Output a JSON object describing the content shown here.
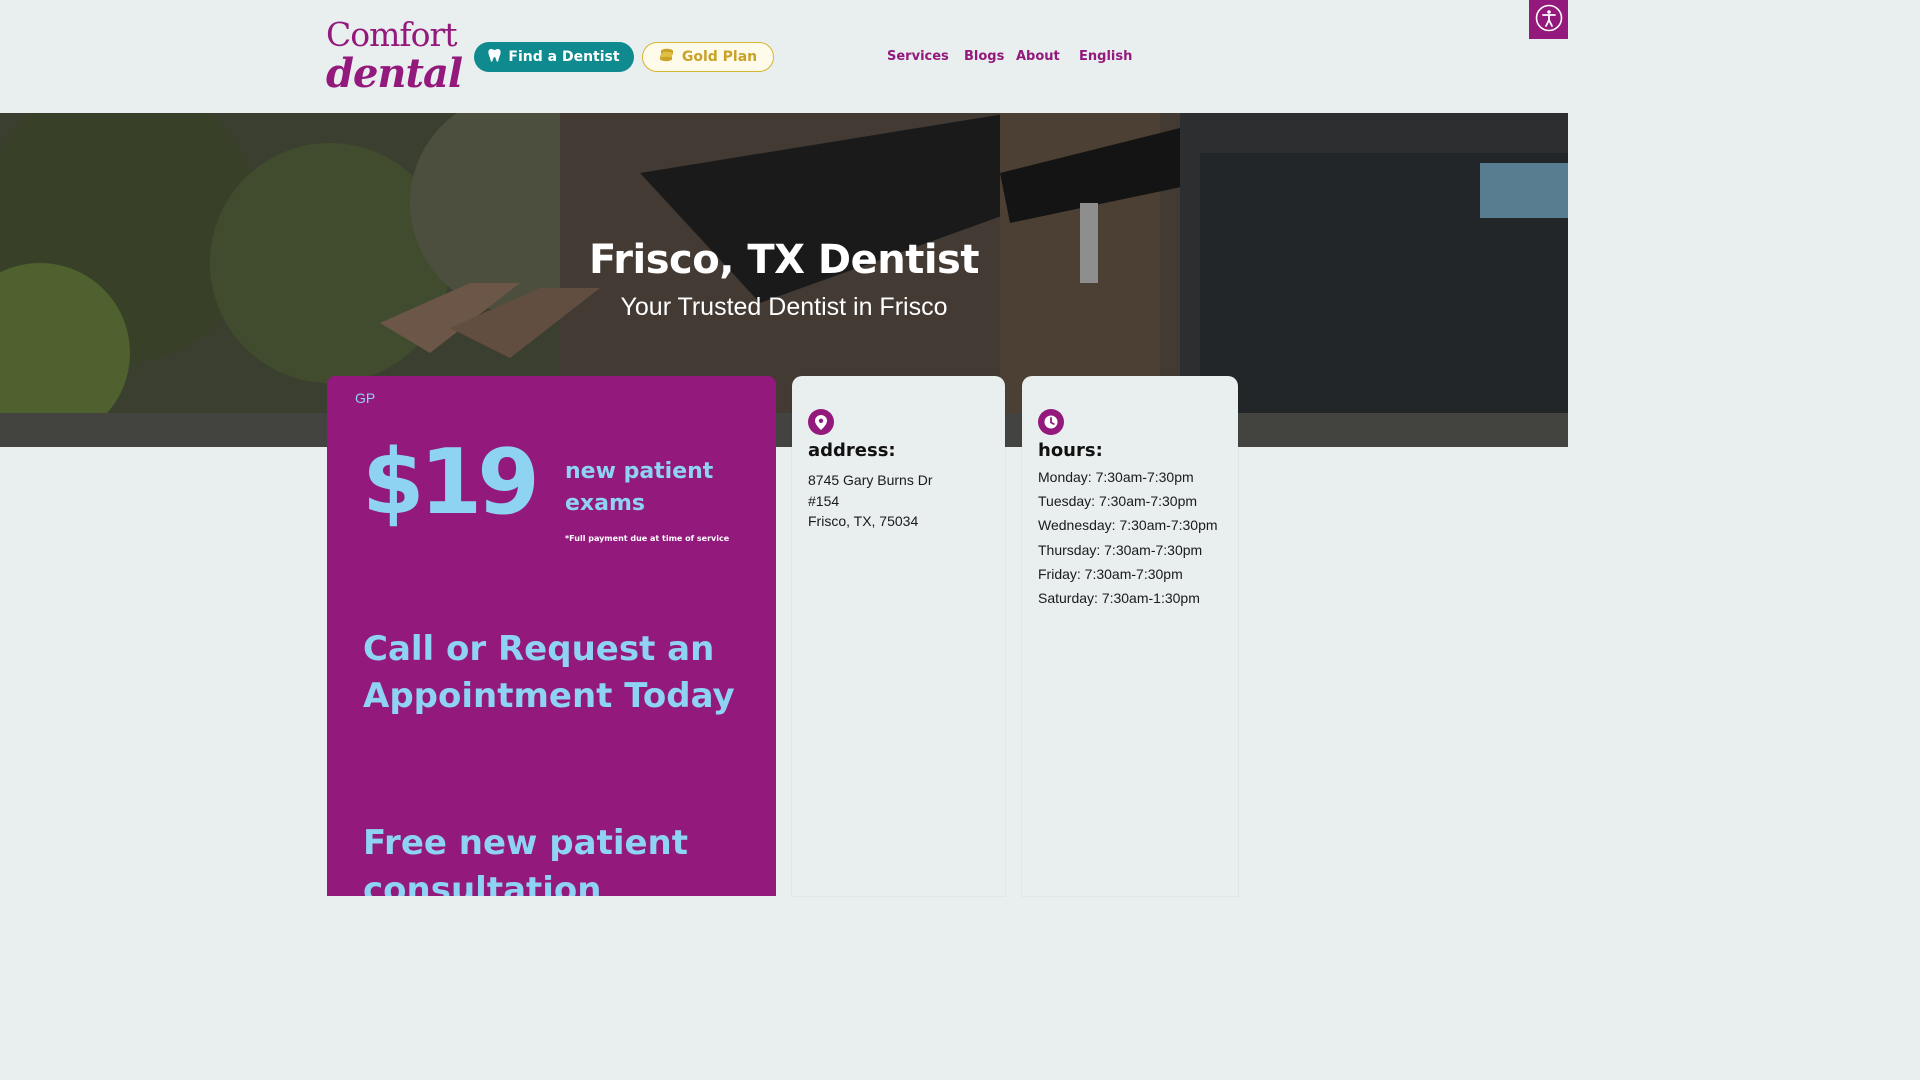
{
  "header": {
    "logo": {
      "line1": "Comfort",
      "line2": "dental"
    },
    "find_dentist_label": "Find a Dentist",
    "gold_plan_label": "Gold Plan",
    "nav": [
      "Services",
      "Blogs",
      "About",
      "English"
    ]
  },
  "hero": {
    "title": "Frisco, TX Dentist",
    "subtitle": "Your Trusted Dentist in Frisco"
  },
  "promo": {
    "tag": "GP",
    "price": "$19",
    "price_label": "new patient exams",
    "price_note": "*Full payment due at time of service",
    "cta": "Call or Request an Appointment Today",
    "free_offer": "Free new patient consultation"
  },
  "address_card": {
    "label": "address:",
    "lines": [
      "8745 Gary Burns Dr",
      "#154",
      "Frisco, TX, 75034"
    ]
  },
  "hours_card": {
    "label": "hours:",
    "lines": [
      "Monday: 7:30am-7:30pm",
      "Tuesday: 7:30am-7:30pm",
      "Wednesday: 7:30am-7:30pm",
      "Thursday: 7:30am-7:30pm",
      "Friday: 7:30am-7:30pm",
      "Saturday: 7:30am-1:30pm"
    ]
  },
  "colors": {
    "brand_purple": "#93197d",
    "teal": "#0f8a8f",
    "gold": "#c9a227",
    "light_blue": "#8fd3f2",
    "background": "#e9eeee"
  },
  "icons": [
    "tooth-icon",
    "coins-icon",
    "accessibility-icon",
    "location-pin-icon",
    "clock-icon"
  ]
}
